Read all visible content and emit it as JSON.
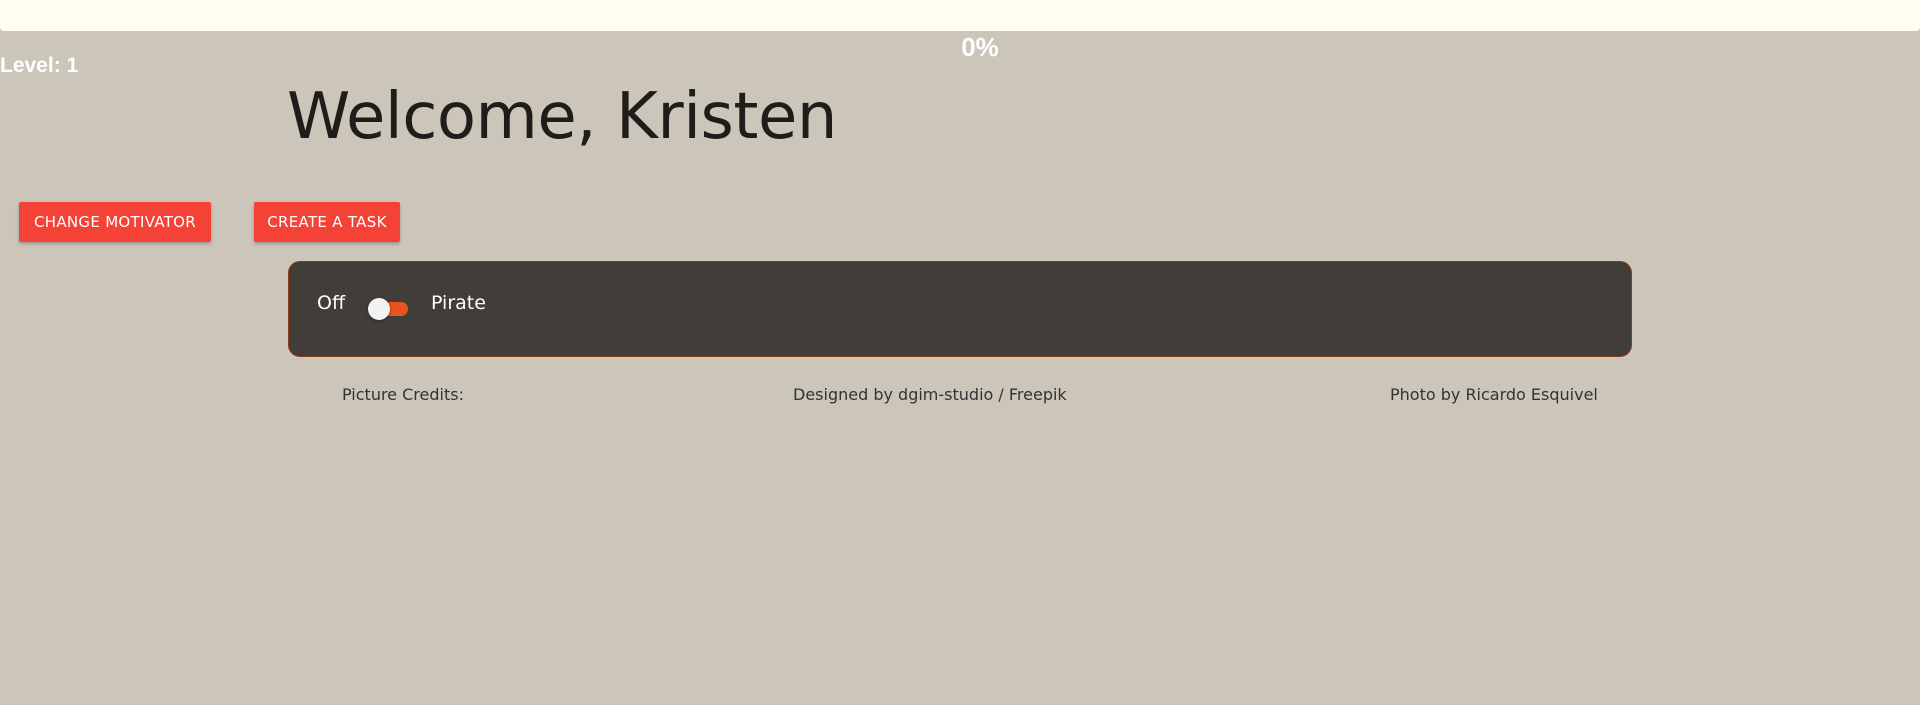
{
  "progress": {
    "value_percent": 0,
    "label": "0%"
  },
  "level": {
    "label": "Level: 1"
  },
  "welcome": {
    "title": "Welcome, Kristen"
  },
  "buttons": {
    "change_motivator": "CHANGE MOTIVATOR",
    "create_task": "CREATE A TASK"
  },
  "motivator_panel": {
    "off_label": "Off",
    "on_label": "Pirate",
    "toggle_state": "off",
    "toggle_icon": "toggle-switch-icon"
  },
  "credits": {
    "label": "Picture Credits:",
    "items": [
      "Designed by dgim-studio / Freepik",
      "Photo by Ricardo Esquivel"
    ]
  },
  "colors": {
    "background": "#ccc5ba",
    "progress_track": "#fffef0",
    "button": "#f44336",
    "panel": "#413d39",
    "toggle_track": "#e8541e"
  }
}
